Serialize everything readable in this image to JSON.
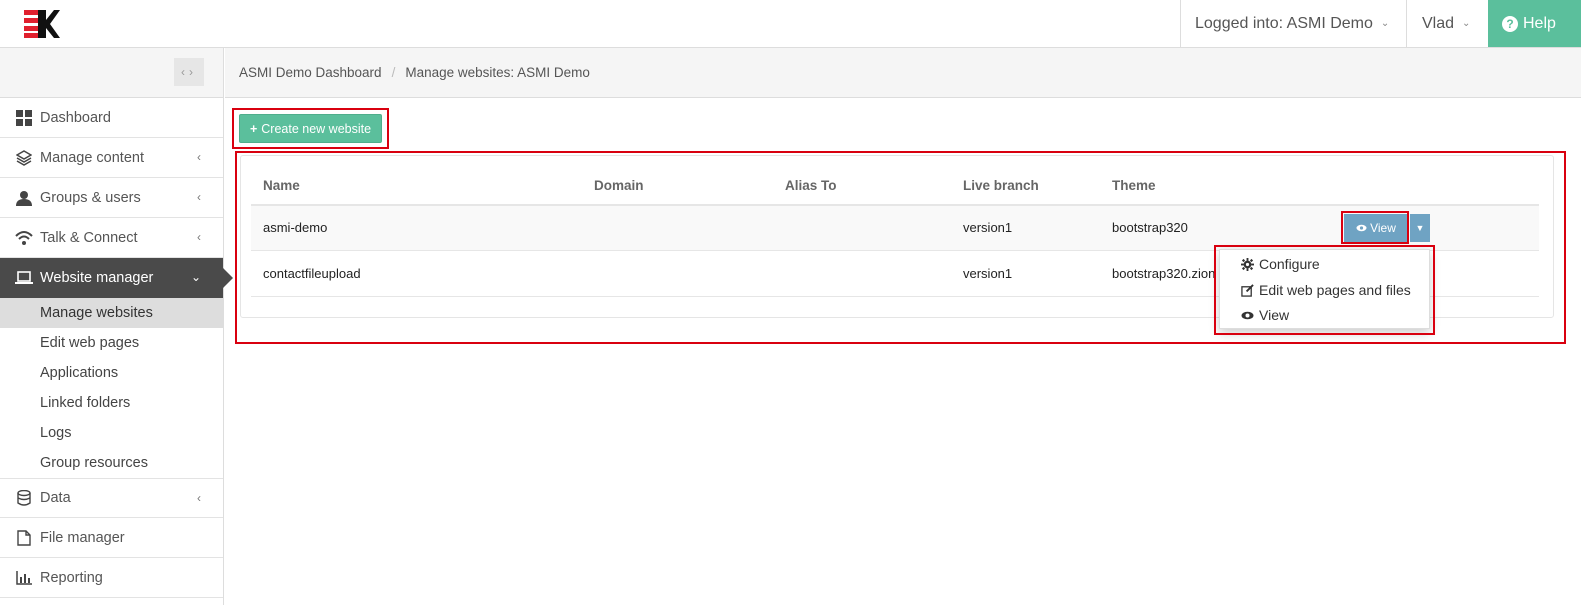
{
  "header": {
    "logged_in_label": "Logged into: ASMI Demo",
    "user_label": "Vlad",
    "help_label": "Help"
  },
  "sidebar": {
    "items": [
      {
        "label": "Dashboard",
        "icon": "dashboard-grid-icon"
      },
      {
        "label": "Manage content",
        "icon": "layers-icon"
      },
      {
        "label": "Groups & users",
        "icon": "user-icon"
      },
      {
        "label": "Talk & Connect",
        "icon": "wifi-icon"
      },
      {
        "label": "Website manager",
        "icon": "laptop-icon"
      }
    ],
    "subitems": [
      "Manage websites",
      "Edit web pages",
      "Applications",
      "Linked folders",
      "Logs",
      "Group resources"
    ],
    "items_after": [
      {
        "label": "Data",
        "icon": "database-icon"
      },
      {
        "label": "File manager",
        "icon": "file-icon"
      },
      {
        "label": "Reporting",
        "icon": "bar-chart-icon"
      }
    ]
  },
  "breadcrumb": {
    "home": "ASMI Demo Dashboard",
    "separator": "/",
    "current": "Manage websites: ASMI Demo"
  },
  "create_button": {
    "icon": "+",
    "label": "Create new website"
  },
  "table": {
    "headers": [
      "Name",
      "Domain",
      "Alias To",
      "Live branch",
      "Theme"
    ],
    "rows": [
      {
        "name": "asmi-demo",
        "domain": "",
        "alias": "",
        "branch": "version1",
        "theme": "bootstrap320"
      },
      {
        "name": "contactfileupload",
        "domain": "",
        "alias": "",
        "branch": "version1",
        "theme": "bootstrap320.zion"
      }
    ]
  },
  "view_button": {
    "label": "View"
  },
  "dropdown": {
    "items": [
      {
        "label": "Configure",
        "icon": "gear-icon"
      },
      {
        "label": "Edit web pages and files",
        "icon": "edit-icon"
      },
      {
        "label": "View",
        "icon": "eye-icon"
      }
    ]
  },
  "colors": {
    "accent": "#5bbf9c",
    "active_nav": "#4a4a4a",
    "view_button": "#6fa3c3",
    "highlight": "#d9000f"
  }
}
